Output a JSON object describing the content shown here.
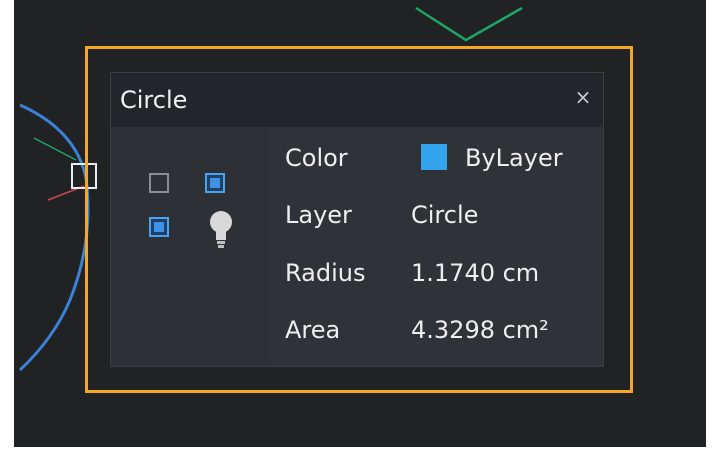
{
  "panel": {
    "title": "Circle",
    "close_glyph": "×"
  },
  "properties": [
    {
      "label": "Color",
      "value": "ByLayer"
    },
    {
      "label": "Layer",
      "value": "Circle"
    },
    {
      "label": "Radius",
      "value": "1.1740 cm"
    },
    {
      "label": "Area",
      "value": "4.3298 cm²"
    }
  ],
  "colors": {
    "highlight": "#f5a623",
    "swatch": "#32a4ec",
    "circle_curve": "#3b82d6",
    "guide_line": "#1ea56a"
  },
  "icons": {
    "toggles": [
      "unchecked-box-icon",
      "checked-box-icon",
      "checked-box-icon"
    ],
    "bulb": "light-bulb-icon",
    "close": "close-icon"
  }
}
